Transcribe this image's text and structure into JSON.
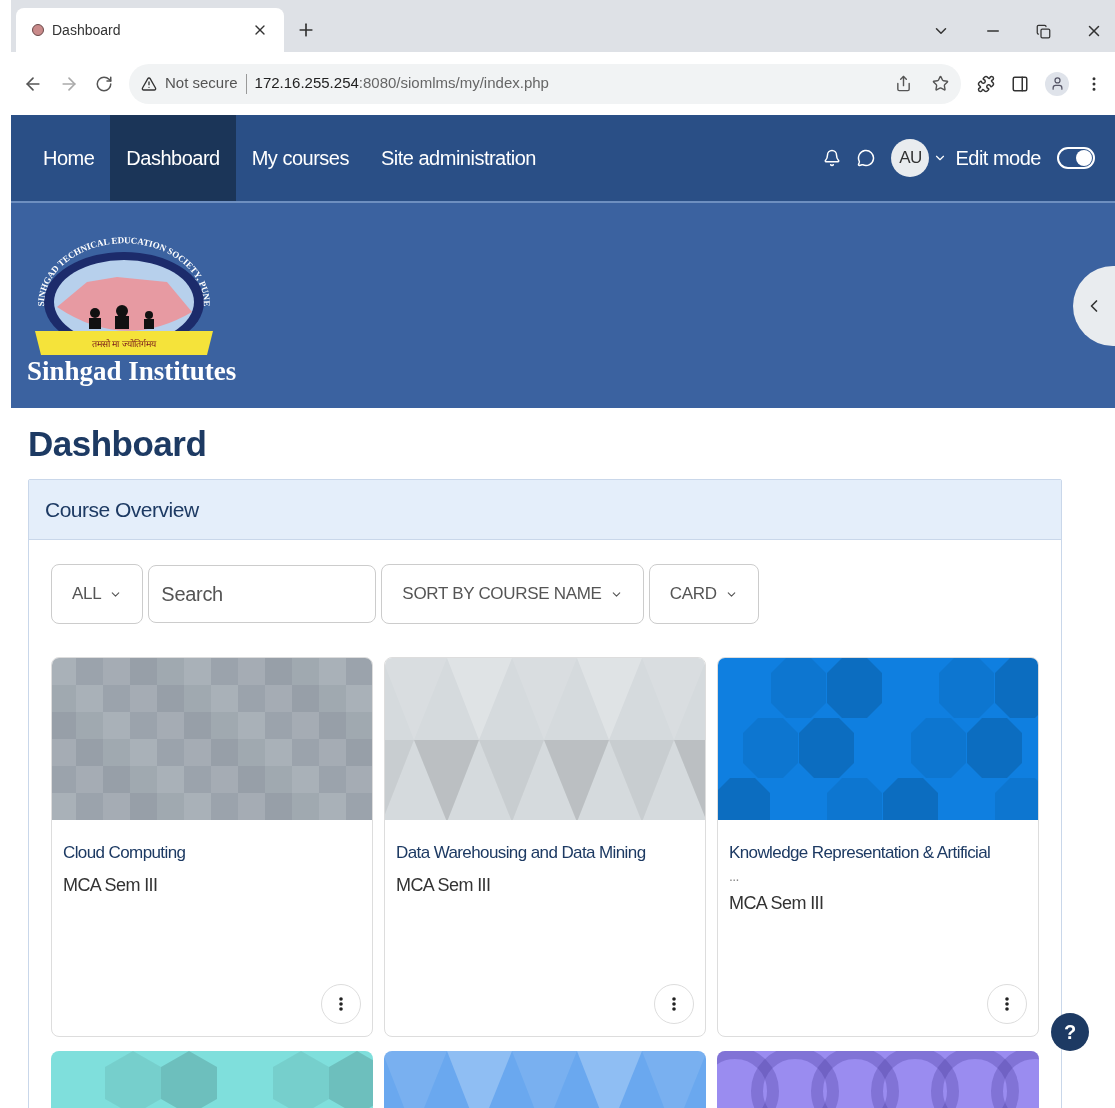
{
  "browser": {
    "tab_title": "Dashboard",
    "security": "Not secure",
    "url_host": "172.16.255.254",
    "url_rest": ":8080/siomlms/my/index.php"
  },
  "navbar": {
    "items": [
      {
        "label": "Home",
        "selected": false
      },
      {
        "label": "Dashboard",
        "selected": true
      },
      {
        "label": "My courses",
        "selected": false
      },
      {
        "label": "Site administration",
        "selected": false
      }
    ],
    "avatar": "AU",
    "edit_mode": {
      "label": "Edit mode",
      "on": true
    }
  },
  "header": {
    "logo_arc": "SINHGAD TECHNICAL EDUCATION SOCIETY, PUNE",
    "logo_motto": "तमसो मा ज्योतिर्गमय",
    "brand": "Sinhgad Institutes"
  },
  "page_title": "Dashboard",
  "course_overview": {
    "title": "Course Overview",
    "filters": {
      "grouping": "ALL",
      "search_placeholder": "Search",
      "sort": "SORT BY COURSE NAME",
      "view": "CARD"
    },
    "courses": [
      {
        "name": "Cloud Computing",
        "category": "MCA Sem III",
        "color": "#a9b1b8"
      },
      {
        "name": "Data Warehousing and Data Mining",
        "category": "MCA Sem III",
        "color": "#d5dadd"
      },
      {
        "name": "Knowledge Representation & Artificial",
        "overflow_mark": "...",
        "category": "MCA Sem III",
        "color": "#0f7fe0"
      },
      {
        "color": "#7fdfdc"
      },
      {
        "color": "#6aa8ef"
      },
      {
        "color": "#9a8cf0"
      }
    ]
  },
  "help": "?"
}
